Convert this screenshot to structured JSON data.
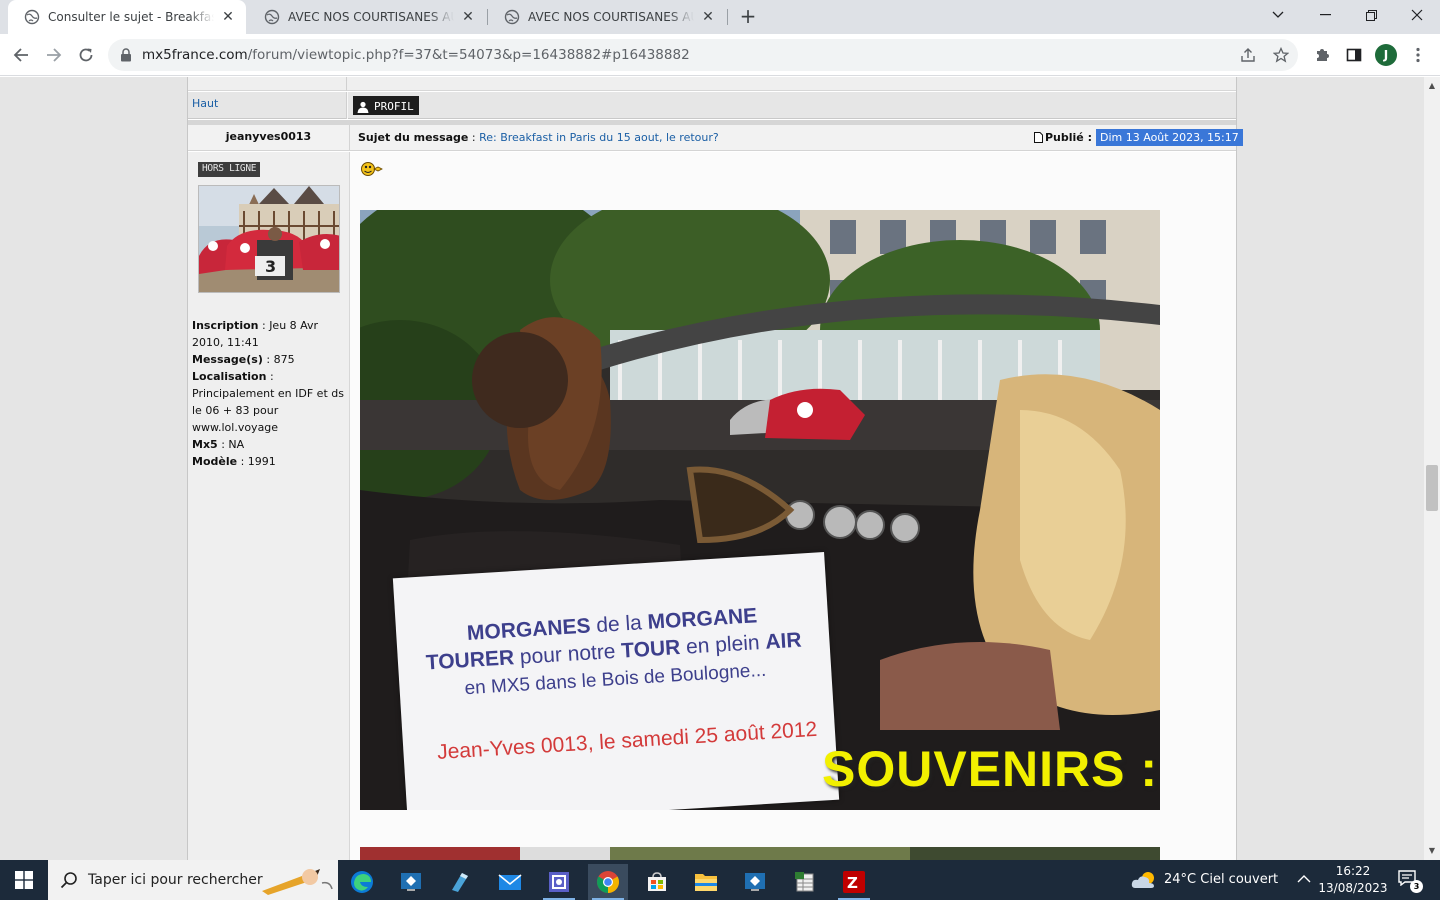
{
  "browser": {
    "tabs": [
      {
        "title": "Consulter le sujet - Breakfast in Paris",
        "active": true
      },
      {
        "title": "AVEC NOS COURTISANES AU BOIS",
        "active": false
      },
      {
        "title": "AVEC NOS COURTISANES AU BOIS",
        "active": false
      }
    ],
    "new_tab": "+",
    "url_host": "mx5france.com",
    "url_path": "/forum/viewtopic.php?f=37&t=54073&p=16438882#p16438882",
    "profile_initial": "J"
  },
  "forum": {
    "haut_label": "Haut",
    "profil_label": "PROFIL",
    "post": {
      "author": "jeanyves0013",
      "subject_label": "Sujet du message",
      "subject_sep": " : ",
      "subject_text": "Re: Breakfast in Paris du 15 aout, le retour?",
      "published_label": "Publié :",
      "published_date": "Dim 13 Août 2023, 15:17",
      "status": "HORS LIGNE",
      "profile": [
        {
          "label": "Inscription",
          "sep": " : ",
          "value": "Jeu 8 Avr 2010, 11:41"
        },
        {
          "label": "Message(s)",
          "sep": " : ",
          "value": "875"
        },
        {
          "label": "Localisation",
          "sep": " : ",
          "value": "Principalement en IDF et ds le 06 + 83 pour www.lol.voyage"
        },
        {
          "label": "Mx5",
          "sep": " : ",
          "value": "NA"
        },
        {
          "label": "Modèle",
          "sep": " : ",
          "value": "1991"
        }
      ],
      "sign": {
        "line1_a": "MORGANES",
        "line1_b": " de la ",
        "line1_c": "MORGANE",
        "line2_a": "TOURER",
        "line2_b": " pour notre ",
        "line2_c": "TOUR",
        "line2_d": " en plein ",
        "line2_e": "AIR",
        "line3": "en MX5 dans le Bois de Boulogne...",
        "line4": "Jean-Yves 0013, le samedi 25 août 2012"
      },
      "caption": "SOUVENIRS :"
    }
  },
  "taskbar": {
    "search_placeholder": "Taper ici pour rechercher",
    "weather": "24°C  Ciel couvert",
    "time": "16:22",
    "date": "13/08/2023",
    "notifications": "3"
  }
}
